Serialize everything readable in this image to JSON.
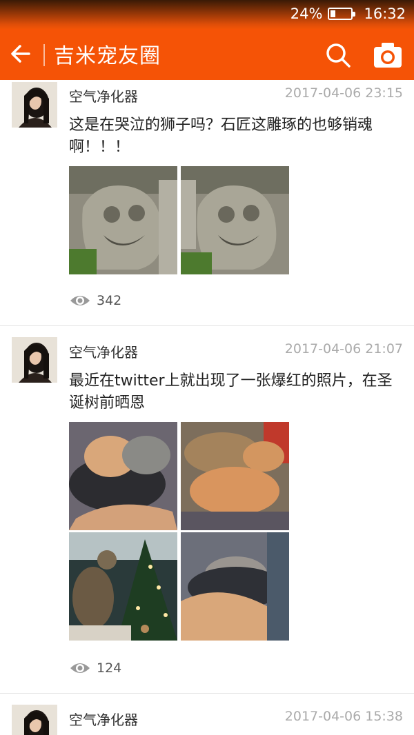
{
  "status_bar": {
    "battery_percent_label": "24%",
    "battery_level": 0.24,
    "time": "16:32"
  },
  "app_bar": {
    "title": "吉米宠友圈",
    "back_icon": "back-arrow-icon",
    "search_icon": "search-icon",
    "camera_icon": "camera-icon"
  },
  "posts": [
    {
      "username": "空气净化器",
      "timestamp": "2017-04-06 23:15",
      "text": "这是在哭泣的狮子吗？石匠这雕琢的也够销魂啊！！！",
      "views": "342",
      "images": [
        "stone-lion-photo-1",
        "stone-lion-photo-2"
      ]
    },
    {
      "username": "空气净化器",
      "timestamp": "2017-04-06 21:07",
      "text": "最近在twitter上就出现了一张爆红的照片，在圣诞树前晒恩",
      "views": "124",
      "images": [
        "cats-hugging-photo",
        "cats-cuddling-photo",
        "cats-christmas-tree-photo",
        "cats-sleeping-photo"
      ]
    },
    {
      "username": "空气净化器",
      "timestamp": "2017-04-06 15:38"
    }
  ],
  "colors": {
    "accent": "#f55306",
    "timestamp": "#aaaaaa"
  }
}
